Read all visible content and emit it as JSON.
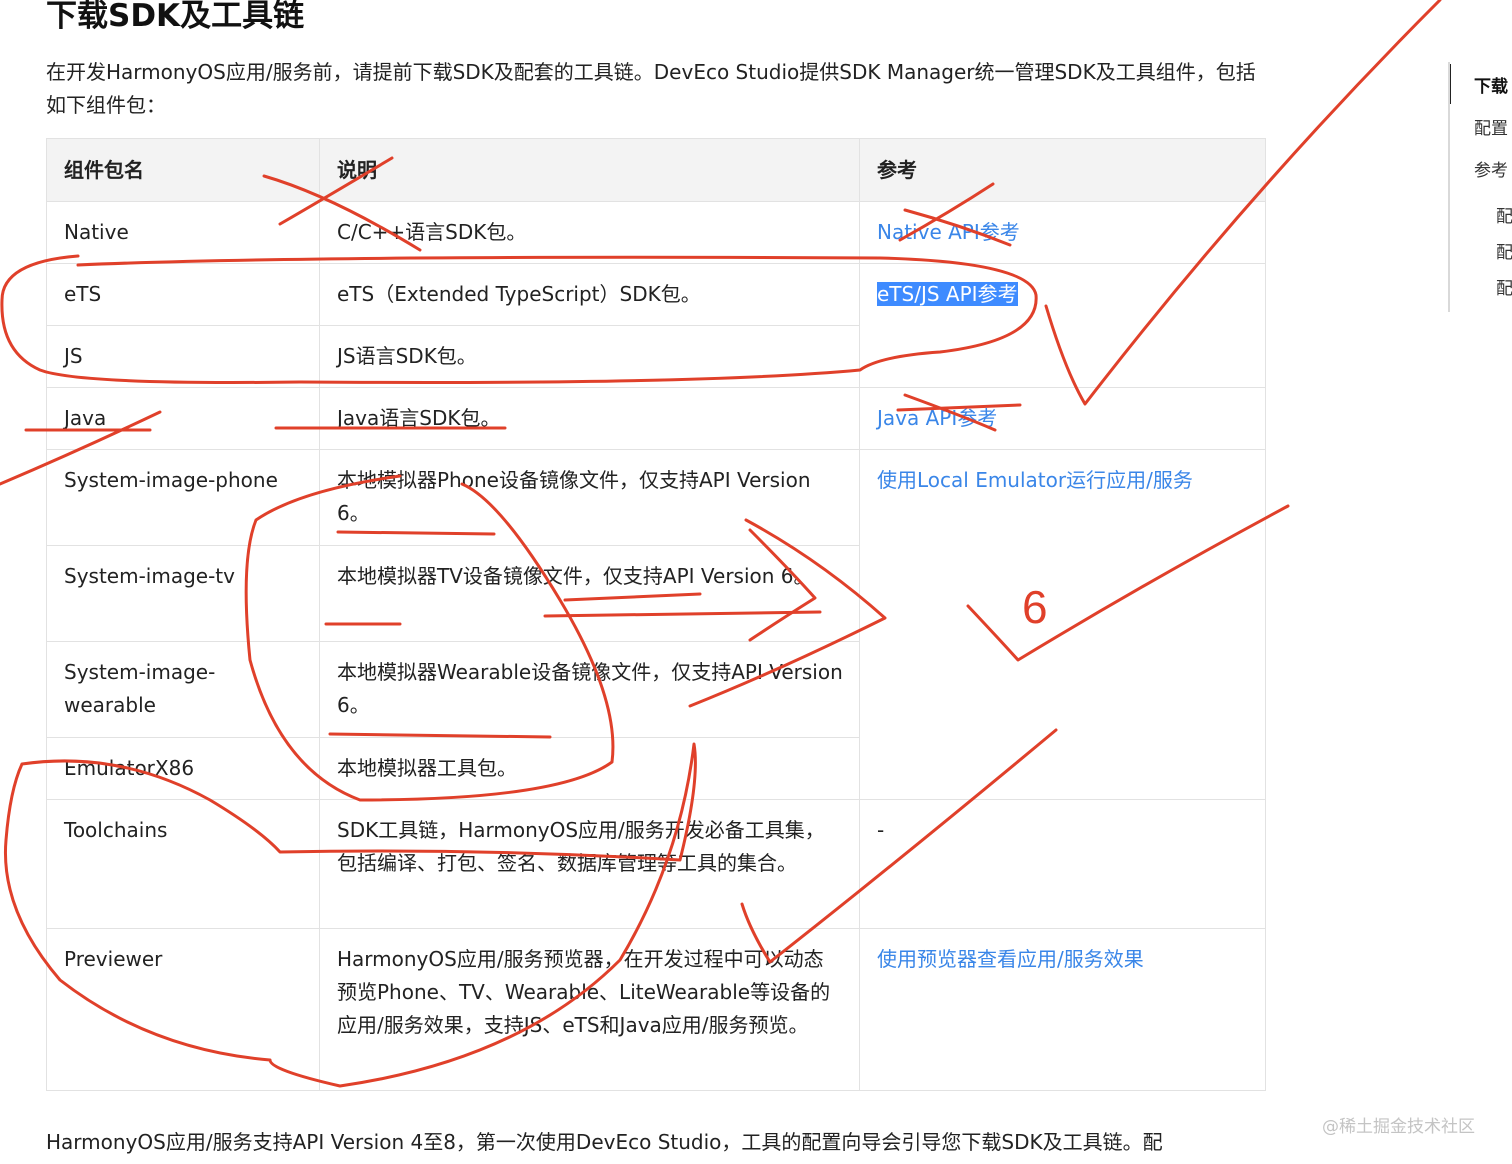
{
  "document": {
    "title": "下载SDK及工具链",
    "intro": "在开发HarmonyOS应用/服务前，请提前下载SDK及配套的工具链。DevEco Studio提供SDK Manager统一管理SDK及工具组件，包括如下组件包：",
    "footer": "HarmonyOS应用/服务支持API Version 4至8，第一次使用DevEco Studio，工具的配置向导会引导您下载SDK及工具链。配"
  },
  "table": {
    "headers": [
      "组件包名",
      "说明",
      "参考"
    ],
    "rows": [
      {
        "name": "Native",
        "desc": "C/C++语言SDK包。",
        "ref": "Native API参考"
      },
      {
        "name": "eTS",
        "desc": "eTS（Extended TypeScript）SDK包。",
        "ref": "eTS/JS API参考"
      },
      {
        "name": "JS",
        "desc": "JS语言SDK包。"
      },
      {
        "name": "Java",
        "desc": "Java语言SDK包。",
        "ref": "Java API参考"
      },
      {
        "name": "System-image-phone",
        "desc": "本地模拟器Phone设备镜像文件，仅支持API Version 6。",
        "ref": "使用Local Emulator运行应用/服务"
      },
      {
        "name": "System-image-tv",
        "desc": "本地模拟器TV设备镜像文件，仅支持API Version 6。"
      },
      {
        "name": "System-image-wearable",
        "desc": "本地模拟器Wearable设备镜像文件，仅支持API Version 6。"
      },
      {
        "name": "EmulatorX86",
        "desc": "本地模拟器工具包。"
      },
      {
        "name": "Toolchains",
        "desc": "SDK工具链，HarmonyOS应用/服务开发必备工具集，包括编译、打包、签名、数据库管理等工具的集合。",
        "ref": "-"
      },
      {
        "name": "Previewer",
        "desc": "HarmonyOS应用/服务预览器，在开发过程中可以动态预览Phone、TV、Wearable、LiteWearable等设备的应用/服务效果，支持JS、eTS和Java应用/服务预览。",
        "ref": "使用预览器查看应用/服务效果"
      }
    ]
  },
  "toc": {
    "items": [
      "下载",
      "配置",
      "参考",
      "配",
      "配",
      "配"
    ]
  },
  "annotation": {
    "digit": "6"
  },
  "watermark": "@稀土掘金技术社区",
  "colors": {
    "link": "#3a86e8",
    "selection": "#3e8bff",
    "ink": "#e0402a"
  }
}
